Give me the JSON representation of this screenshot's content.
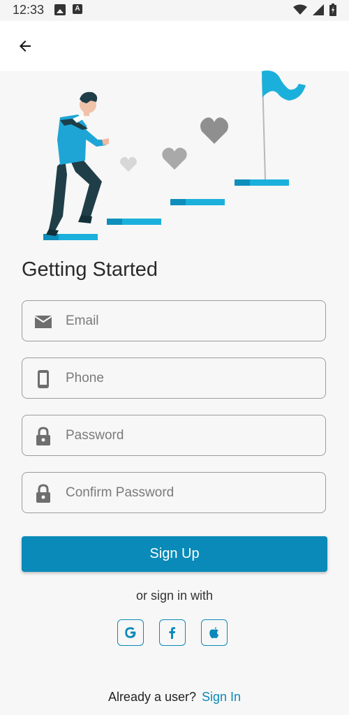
{
  "status_bar": {
    "time": "12:33"
  },
  "header": {
    "back_label": "Back"
  },
  "main": {
    "title": "Getting Started",
    "fields": {
      "email": {
        "placeholder": "Email",
        "value": ""
      },
      "phone": {
        "placeholder": "Phone",
        "value": ""
      },
      "password": {
        "placeholder": "Password",
        "value": ""
      },
      "confirm_password": {
        "placeholder": "Confirm Password",
        "value": ""
      }
    },
    "signup_label": "Sign Up",
    "or_text": "or sign in with",
    "social": [
      {
        "name": "google-icon",
        "glyph": "G"
      },
      {
        "name": "facebook-icon",
        "glyph": "f"
      },
      {
        "name": "apple-icon",
        "glyph": ""
      }
    ]
  },
  "footer": {
    "question": "Already a user?",
    "link": "Sign In"
  },
  "colors": {
    "accent": "#0a8ab8",
    "background": "#f7f7f7",
    "heart": "#9a9a9a"
  }
}
